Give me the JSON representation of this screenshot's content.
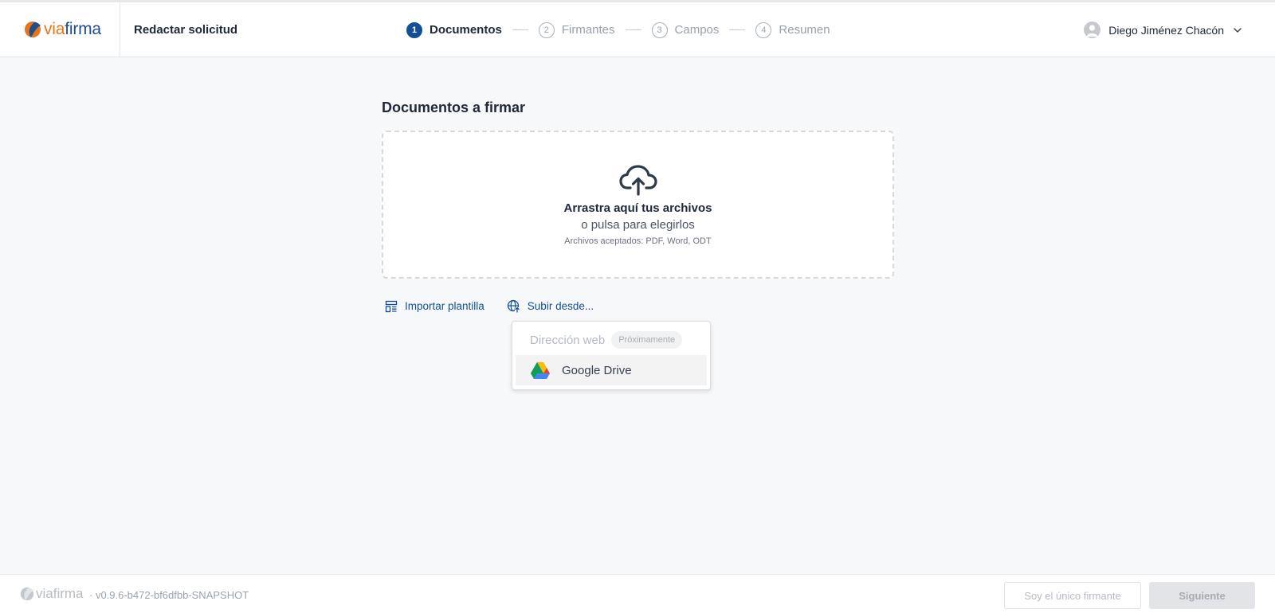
{
  "brand": {
    "logo_via": "via",
    "logo_firma": "firma",
    "accent": "#134f96",
    "orange": "#e8741c"
  },
  "header": {
    "title": "Redactar solicitud"
  },
  "steps": [
    {
      "number": "1",
      "label": "Documentos",
      "active": true
    },
    {
      "number": "2",
      "label": "Firmantes",
      "active": false
    },
    {
      "number": "3",
      "label": "Campos",
      "active": false
    },
    {
      "number": "4",
      "label": "Resumen",
      "active": false
    }
  ],
  "user": {
    "name": "Diego Jiménez Chacón",
    "icon": "chevron-down-icon"
  },
  "main": {
    "title": "Documentos a firmar",
    "dropzone": {
      "icon": "cloud-upload-icon",
      "primary": "Arrastra aquí tus archivos",
      "secondary": "o pulsa para elegirlos",
      "note": "Archivos aceptados: PDF, Word, ODT"
    },
    "actions": {
      "import_template": "Importar plantilla",
      "upload_from": "Subir desde..."
    },
    "dropdown": {
      "web_address": "Dirección web",
      "coming_soon": "Próximamente",
      "google_drive": "Google Drive"
    }
  },
  "footer": {
    "version": "· v0.9.6-b472-bf6dfbb-SNAPSHOT",
    "only_signer": "Soy el único firmante",
    "next": "Siguiente"
  }
}
